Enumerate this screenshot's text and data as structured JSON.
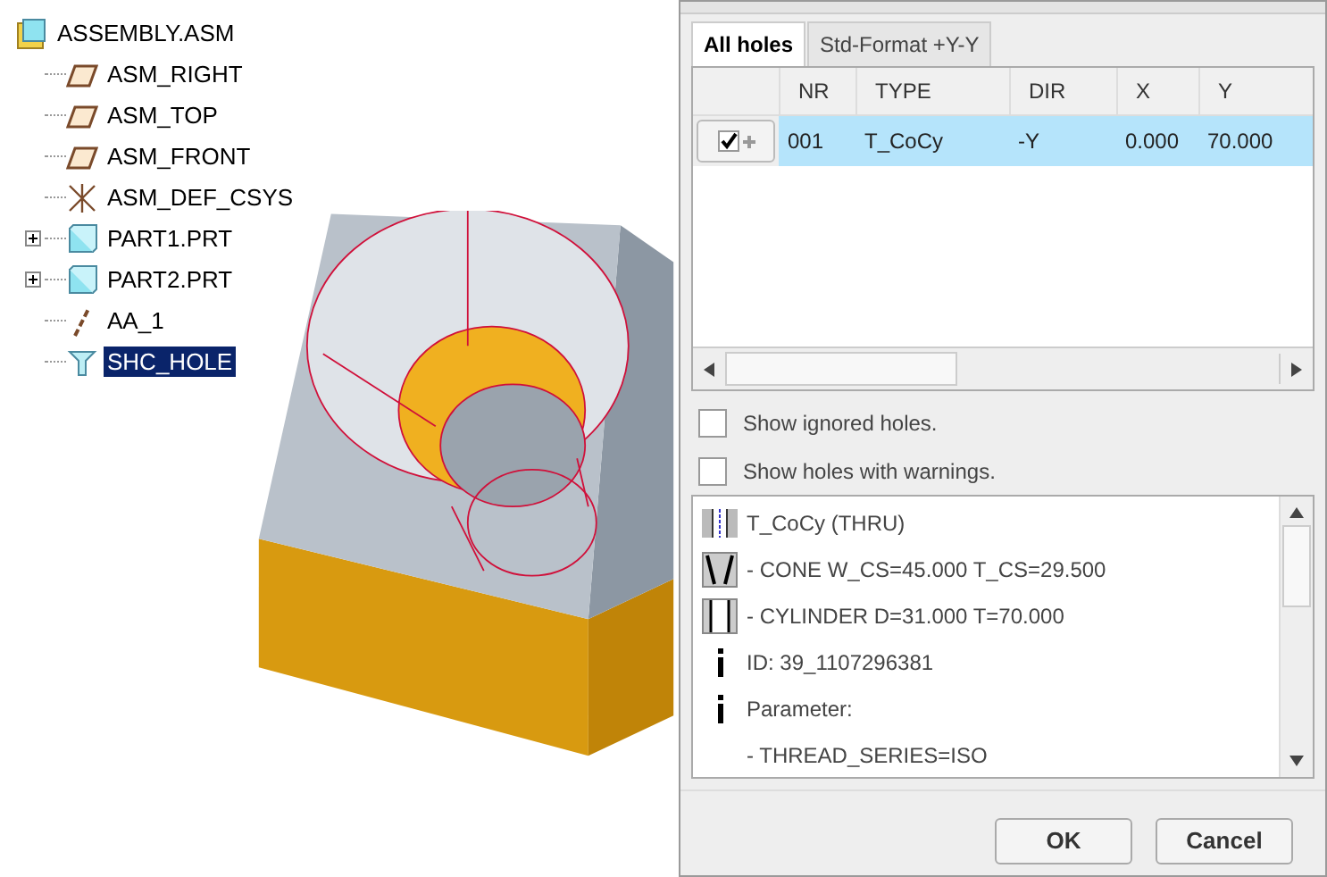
{
  "tree": {
    "label": "ASSEMBLY.ASM",
    "kind": "assembly",
    "selected": false,
    "children": [
      {
        "label": "ASM_RIGHT",
        "kind": "plane",
        "expandable": false,
        "selected": false
      },
      {
        "label": "ASM_TOP",
        "kind": "plane",
        "expandable": false,
        "selected": false
      },
      {
        "label": "ASM_FRONT",
        "kind": "plane",
        "expandable": false,
        "selected": false
      },
      {
        "label": "ASM_DEF_CSYS",
        "kind": "csys",
        "expandable": false,
        "selected": false
      },
      {
        "label": "PART1.PRT",
        "kind": "part",
        "expandable": true,
        "selected": false
      },
      {
        "label": "PART2.PRT",
        "kind": "part",
        "expandable": true,
        "selected": false
      },
      {
        "label": "AA_1",
        "kind": "axis",
        "expandable": false,
        "selected": false
      },
      {
        "label": "SHC_HOLE",
        "kind": "hole",
        "expandable": false,
        "selected": true
      }
    ]
  },
  "dialog": {
    "tabs": [
      {
        "label": "All holes",
        "selected": true
      },
      {
        "label": "Std-Format +Y-Y",
        "selected": false
      }
    ],
    "table": {
      "columns": [
        "NR",
        "TYPE",
        "DIR",
        "X",
        "Y"
      ],
      "rows": [
        {
          "checked": true,
          "selected": true,
          "cells": [
            "001",
            "T_CoCy",
            "-Y",
            "0.000",
            "70.000"
          ]
        }
      ]
    },
    "options": [
      {
        "label": "Show ignored holes.",
        "checked": false
      },
      {
        "label": "Show holes with warnings.",
        "checked": false
      }
    ],
    "details": [
      {
        "kind": "hole",
        "text": "T_CoCy (THRU)"
      },
      {
        "kind": "cone",
        "text": "- CONE  W_CS=45.000 T_CS=29.500"
      },
      {
        "kind": "cylinder",
        "text": "- CYLINDER  D=31.000 T=70.000"
      },
      {
        "kind": "info",
        "text": "ID: 39_1107296381"
      },
      {
        "kind": "info",
        "text": "Parameter:"
      },
      {
        "kind": "none",
        "text": "- THREAD_SERIES=ISO"
      }
    ],
    "buttons": [
      "OK",
      "Cancel"
    ]
  }
}
